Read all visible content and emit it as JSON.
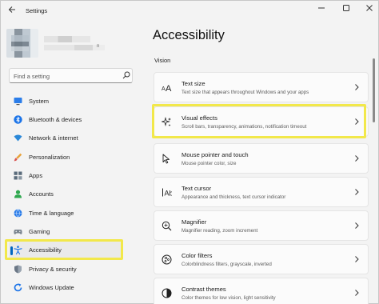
{
  "window": {
    "title": "Settings",
    "back_icon": "arrow-left-icon",
    "controls": [
      "minimize-icon",
      "maximize-icon",
      "close-icon"
    ]
  },
  "profile": {
    "name_fragment": "n"
  },
  "search": {
    "placeholder": "Find a setting",
    "icon": "search-icon"
  },
  "nav": {
    "items": [
      {
        "label": "System",
        "icon": "monitor-icon"
      },
      {
        "label": "Bluetooth & devices",
        "icon": "bluetooth-icon"
      },
      {
        "label": "Network & internet",
        "icon": "wifi-icon"
      },
      {
        "label": "Personalization",
        "icon": "brush-icon"
      },
      {
        "label": "Apps",
        "icon": "apps-icon"
      },
      {
        "label": "Accounts",
        "icon": "person-icon"
      },
      {
        "label": "Time & language",
        "icon": "globe-clock-icon"
      },
      {
        "label": "Gaming",
        "icon": "gamepad-icon"
      },
      {
        "label": "Accessibility",
        "icon": "accessibility-icon",
        "selected": true
      },
      {
        "label": "Privacy & security",
        "icon": "shield-icon"
      },
      {
        "label": "Windows Update",
        "icon": "update-icon"
      }
    ]
  },
  "main": {
    "title": "Accessibility",
    "section": "Vision",
    "cards": [
      {
        "title": "Text size",
        "subtitle": "Text size that appears throughout Windows and your apps",
        "icon": "text-size-icon"
      },
      {
        "title": "Visual effects",
        "subtitle": "Scroll bars, transparency, animations, notification timeout",
        "icon": "sparkle-icon",
        "highlighted": true
      },
      {
        "title": "Mouse pointer and touch",
        "subtitle": "Mouse pointer color, size",
        "icon": "mouse-pointer-icon"
      },
      {
        "title": "Text cursor",
        "subtitle": "Appearance and thickness, text cursor indicator",
        "icon": "text-cursor-icon"
      },
      {
        "title": "Magnifier",
        "subtitle": "Magnifier reading, zoom increment",
        "icon": "magnifier-icon"
      },
      {
        "title": "Color filters",
        "subtitle": "Colorblindness filters, grayscale, inverted",
        "icon": "color-filter-icon"
      },
      {
        "title": "Contrast themes",
        "subtitle": "Color themes for low vision, light sensitivity",
        "icon": "contrast-icon"
      }
    ]
  },
  "colors": {
    "accent": "#0067c0",
    "highlight": "#f2e84a",
    "background": "#f3f3f3",
    "card": "#fbfbfb"
  }
}
